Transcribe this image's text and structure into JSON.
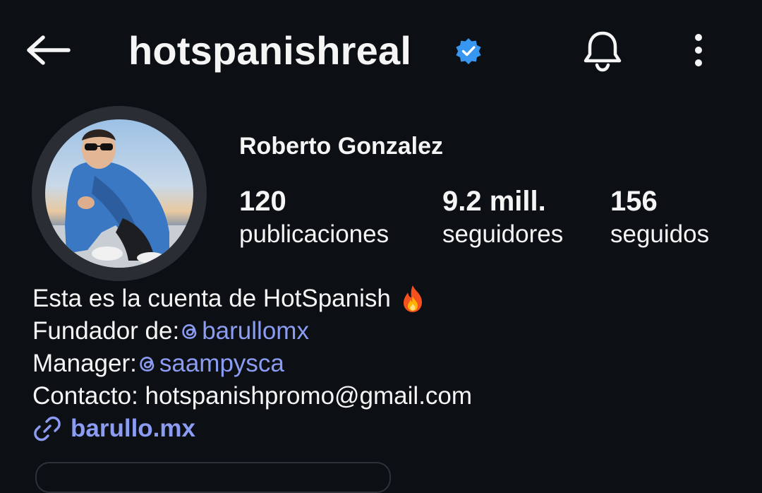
{
  "header": {
    "back_icon": "arrow-left-icon",
    "username": "hotspanishreal",
    "verified_icon": "verified-badge-icon",
    "verified_color": "#3797f0",
    "notifications_icon": "bell-icon",
    "more_icon": "more-vertical-icon"
  },
  "profile": {
    "display_name": "Roberto Gonzalez",
    "avatar_icon": "profile-photo"
  },
  "stats": {
    "posts": {
      "value": "120",
      "label": "publicaciones"
    },
    "followers": {
      "value": "9.2 mill.",
      "label": "seguidores"
    },
    "following": {
      "value": "156",
      "label": "seguidos"
    }
  },
  "bio": {
    "line1": "Esta es la cuenta de HotSpanish",
    "line1_emoji_icon": "fire-emoji-icon",
    "founder_label": "Fundador de: ",
    "founder_handle": "barullomx",
    "manager_label": "Manager: ",
    "manager_handle": "saampysca",
    "contact": "Contacto: hotspanishpromo@gmail.com",
    "mention_icon": "threads-icon",
    "link_icon": "link-icon",
    "link_text": "barullo.mx",
    "link_color": "#8b9cf2"
  }
}
